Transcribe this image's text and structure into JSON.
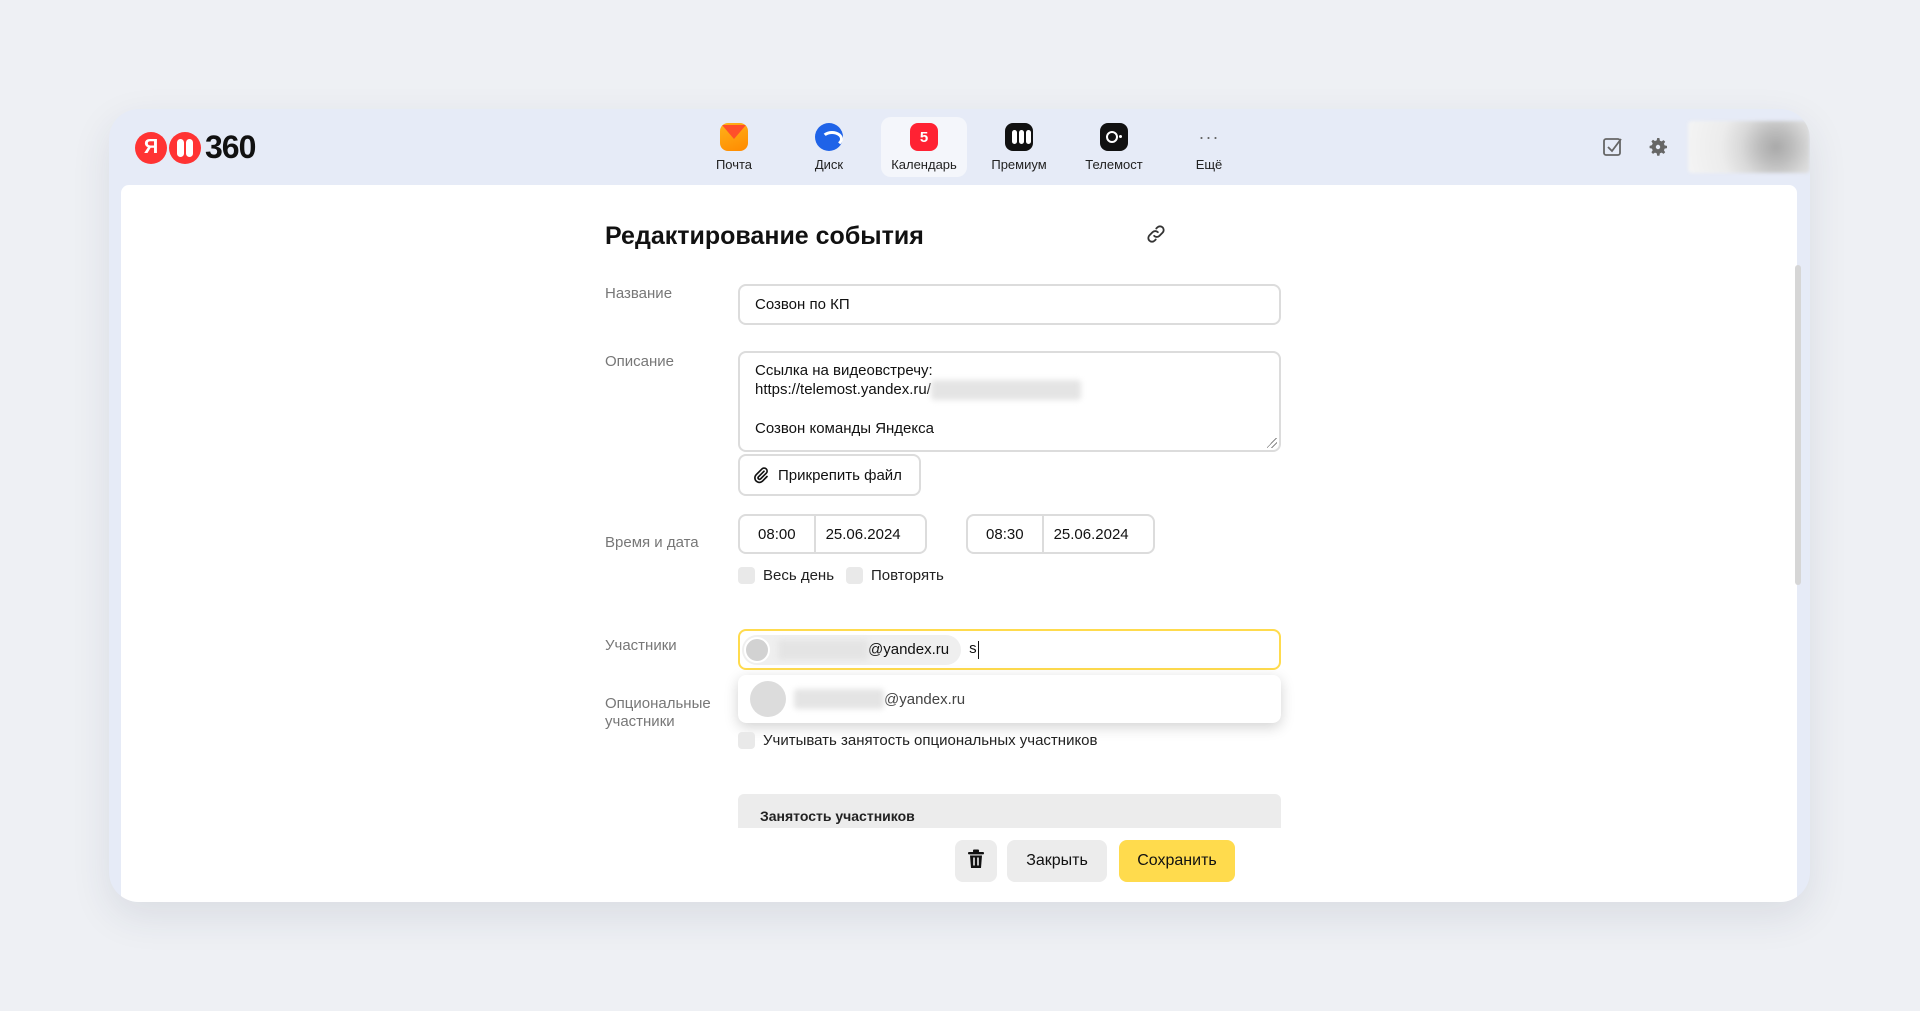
{
  "header": {
    "logo_ya": "Я",
    "logo_text": "360",
    "apps": [
      {
        "label": "Почта",
        "icon": "mail-icon"
      },
      {
        "label": "Диск",
        "icon": "disk-icon"
      },
      {
        "label": "Календарь",
        "icon": "calendar-icon",
        "badge": "5",
        "active": true
      },
      {
        "label": "Премиум",
        "icon": "premium-icon"
      },
      {
        "label": "Телемост",
        "icon": "telemost-icon"
      },
      {
        "label": "Ещё",
        "icon": "more-icon",
        "glyph": "···"
      }
    ],
    "right_icons": [
      "tasks-checkbox-icon",
      "gear-icon"
    ]
  },
  "form": {
    "title": "Редактирование события",
    "name_label": "Название",
    "name_value": "Созвон по КП",
    "description_label": "Описание",
    "description_lines": [
      "Ссылка на видеовстречу:",
      "https://telemost.yandex.ru/",
      "",
      "Созвон команды Яндекса"
    ],
    "attach_label": "Прикрепить файл",
    "datetime_label": "Время и дата",
    "start_time": "08:00",
    "start_date": "25.06.2024",
    "dash": "—",
    "end_time": "08:30",
    "end_date": "25.06.2024",
    "all_day_label": "Весь день",
    "repeat_label": "Повторять",
    "participants_label": "Участники",
    "participant_chip_suffix": "@yandex.ru",
    "participants_typed": "s",
    "optional_label_line1": "Опциональные",
    "optional_label_line2": "участники",
    "suggestion_suffix": "@yandex.ru",
    "consider_optional_label": "Учитывать занятость опциональных участников",
    "busy_title": "Занятость участников"
  },
  "actions": {
    "close_label": "Закрыть",
    "save_label": "Сохранить"
  },
  "colors": {
    "accent_yellow": "#ffdb4d",
    "window_bg": "#e6ebf7",
    "page_bg": "#eef0f4",
    "logo_red": "#ff3333"
  }
}
